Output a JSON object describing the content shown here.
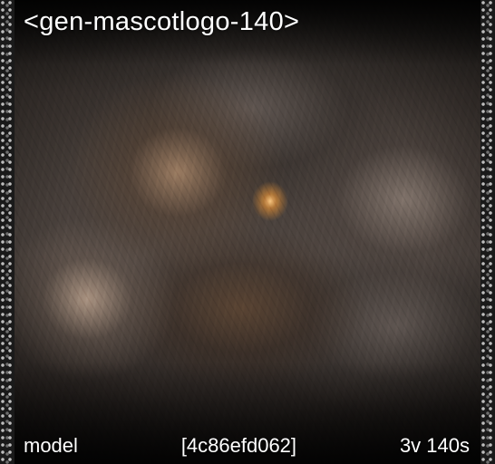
{
  "title": "<gen-mascotlogo-140>",
  "footer": {
    "model": "model",
    "hash": "[4c86efd062]",
    "meta": "3v 140s"
  }
}
